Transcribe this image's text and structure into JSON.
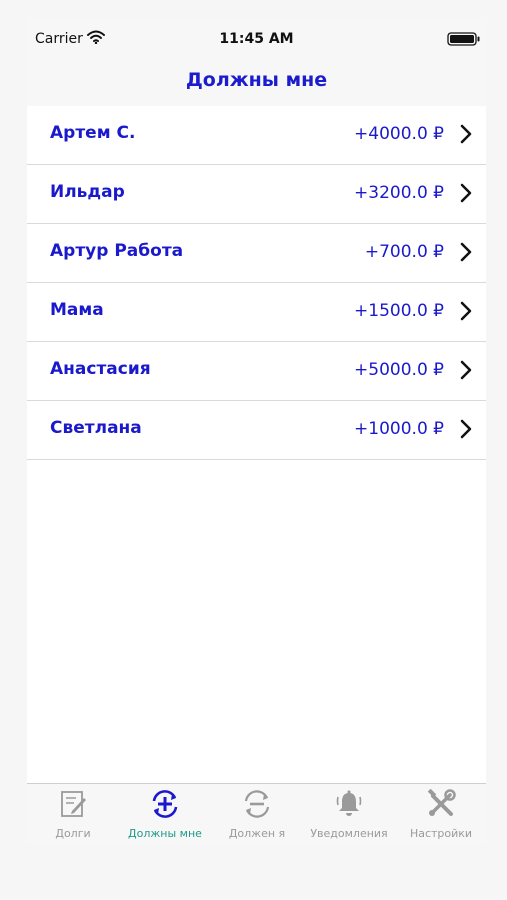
{
  "status": {
    "carrier": "Carrier",
    "time": "11:45 AM"
  },
  "header": {
    "title": "Должны мне"
  },
  "debts": [
    {
      "name": "Артем С.",
      "amount": "+4000.0 ₽"
    },
    {
      "name": "Ильдар",
      "amount": "+3200.0 ₽"
    },
    {
      "name": "Артур Работа",
      "amount": "+700.0 ₽"
    },
    {
      "name": "Мама",
      "amount": "+1500.0 ₽"
    },
    {
      "name": "Анастасия",
      "amount": "+5000.0 ₽"
    },
    {
      "name": "Светлана",
      "amount": "+1000.0 ₽"
    }
  ],
  "tabs": [
    {
      "label": "Долги",
      "icon": "notebook-pencil-icon",
      "active": false
    },
    {
      "label": "Должны мне",
      "icon": "plus-cycle-icon",
      "active": true
    },
    {
      "label": "Должен я",
      "icon": "minus-cycle-icon",
      "active": false
    },
    {
      "label": "Уведомления",
      "icon": "bell-icon",
      "active": false
    },
    {
      "label": "Настройки",
      "icon": "tools-icon",
      "active": false
    }
  ],
  "colors": {
    "accent": "#1a1acc",
    "tab_active": "#1f9a8a",
    "tab_inactive": "#9a9a9a"
  }
}
